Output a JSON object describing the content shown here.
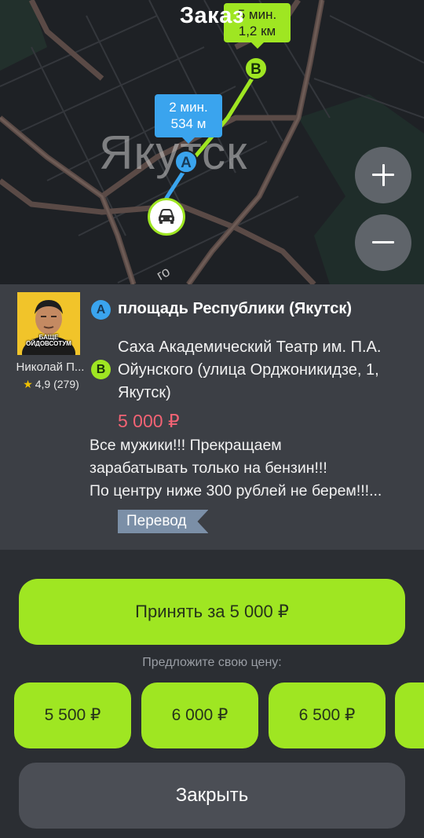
{
  "header": {
    "title": "Заказ"
  },
  "map": {
    "city_label": "Якутск",
    "road_label": "го",
    "bubble_to_b": {
      "time": "5 мин.",
      "distance": "1,2 км"
    },
    "bubble_to_a": {
      "time": "2 мин.",
      "distance": "534 м"
    },
    "pin_a_label": "A",
    "pin_b_label": "B",
    "car_icon": "car-icon",
    "zoom_in_icon": "plus-icon",
    "zoom_out_icon": "minus-icon"
  },
  "order": {
    "driver": {
      "name": "Николай П...",
      "rating": "4,9 (279)",
      "avatar_caption": "БАЩЕ ОЙДОВСОТУМ"
    },
    "from": {
      "marker": "A",
      "address": "площадь Республики (Якутск)"
    },
    "to": {
      "marker": "B",
      "address": "Саха Академический Театр им. П.А. Ойунского (улица Орджоникидзе, 1, Якутск)"
    },
    "price": "5 000 ₽",
    "comment": "Все мужики!!! Прекращаем\nзарабатывать только на бензин!!!\nПо центру ниже 300 рублей не берем!!!...",
    "translate_label": "Перевод"
  },
  "actions": {
    "accept_label": "Принять за 5 000 ₽",
    "suggest_label": "Предложите свою цену:",
    "offers": [
      "5 500 ₽",
      "6 000 ₽",
      "6 500 ₽",
      ""
    ],
    "close_label": "Закрыть"
  },
  "colors": {
    "accent_green": "#9fe622",
    "accent_blue": "#3aa4ee",
    "price_red": "#f36374",
    "panel_bg": "#3c3f45",
    "page_bg": "#2b2e33"
  }
}
